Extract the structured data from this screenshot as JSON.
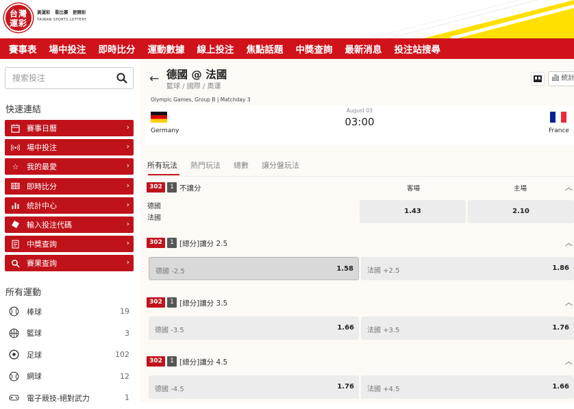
{
  "header": {
    "logo_lines": [
      "台灣",
      "運彩"
    ],
    "slogan": "買運彩　看比賽　更精彩",
    "logo_en": "TAIWAN SPORTS LOTTERY",
    "accent_red": "#d0121b",
    "accent_yellow": "#ffe000"
  },
  "nav": [
    "賽事表",
    "場中投注",
    "即時比分",
    "運動數據",
    "線上投注",
    "焦點話題",
    "中獎查詢",
    "最新消息",
    "投注站搜尋"
  ],
  "sidebar": {
    "search_placeholder": "搜索投注",
    "quick_heading": "快速連結",
    "quick_links": [
      {
        "label": "賽事日曆",
        "icon": "calendar-icon"
      },
      {
        "label": "場中投注",
        "icon": "live-signal-icon"
      },
      {
        "label": "我的最愛",
        "icon": "star-icon"
      },
      {
        "label": "即時比分",
        "icon": "scoreboard-icon"
      },
      {
        "label": "統計中心",
        "icon": "bar-chart-icon"
      },
      {
        "label": "輸入投注代碼",
        "icon": "ticket-icon"
      },
      {
        "label": "中獎查詢",
        "icon": "receipt-icon"
      },
      {
        "label": "賽果查詢",
        "icon": "search-icon"
      }
    ],
    "sports_heading": "所有運動",
    "sports": [
      {
        "label": "棒球",
        "count": "19",
        "icon": "baseball-icon"
      },
      {
        "label": "籃球",
        "count": "3",
        "icon": "basketball-icon"
      },
      {
        "label": "足球",
        "count": "102",
        "icon": "soccer-ball-icon"
      },
      {
        "label": "網球",
        "count": "12",
        "icon": "tennis-ball-icon"
      },
      {
        "label": "電子競技-絕對武力",
        "count": "1",
        "icon": "esports-icon"
      }
    ]
  },
  "match": {
    "title": "德國 @ 法國",
    "breadcrumb": "籃球 / 國際 / 奧運",
    "event": "Olympic Games, Group B | Matchday 3",
    "date": "August 03",
    "time": "03:00",
    "home_team": "Germany",
    "away_team": "France",
    "stats_label": "統計"
  },
  "tabs": [
    "所有玩法",
    "熱門玩法",
    "總數",
    "讓分盤玩法"
  ],
  "markets": [
    {
      "code": "302",
      "num": "1",
      "name": "不讓分",
      "col_away": "客場",
      "col_home": "主場",
      "teams": [
        "德國",
        "法國"
      ],
      "odds": [
        "1.43",
        "2.10"
      ]
    },
    {
      "code": "302",
      "num": "1",
      "name": "[總分]讓分 2.5",
      "left_label": "德國 -2.5",
      "left_odds": "1.58",
      "right_label": "法國 +2.5",
      "right_odds": "1.86"
    },
    {
      "code": "302",
      "num": "1",
      "name": "[總分]讓分 3.5",
      "left_label": "德國 -3.5",
      "left_odds": "1.66",
      "right_label": "法國 +3.5",
      "right_odds": "1.76"
    },
    {
      "code": "302",
      "num": "1",
      "name": "[總分]讓分 4.5",
      "left_label": "德國 -4.5",
      "left_odds": "1.76",
      "right_label": "法國 +4.5",
      "right_odds": "1.66"
    }
  ]
}
